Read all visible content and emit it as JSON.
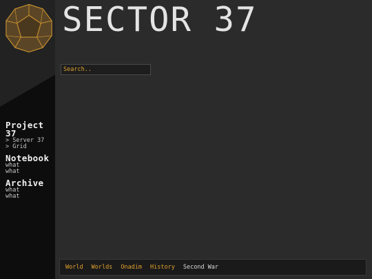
{
  "header": {
    "title": "SECTOR 37"
  },
  "search": {
    "placeholder": "Search.."
  },
  "sidebar": {
    "groups": [
      {
        "title": "Project 37",
        "items": [
          "> Server 37",
          "> Grid"
        ]
      },
      {
        "title": "Notebook",
        "items": [
          "what",
          "what"
        ]
      },
      {
        "title": "Archive",
        "items": [
          "what",
          "what"
        ]
      }
    ]
  },
  "breadcrumb": {
    "items": [
      "World",
      "Worlds",
      "Onadim",
      "History",
      "Second War"
    ]
  },
  "colors": {
    "accent": "#e0a030",
    "logo_fill": "#5a4526",
    "background": "#2b2b2b",
    "sidebar": "#0d0d0d"
  },
  "icons": {
    "logo": "dodecahedron-logo-icon"
  }
}
